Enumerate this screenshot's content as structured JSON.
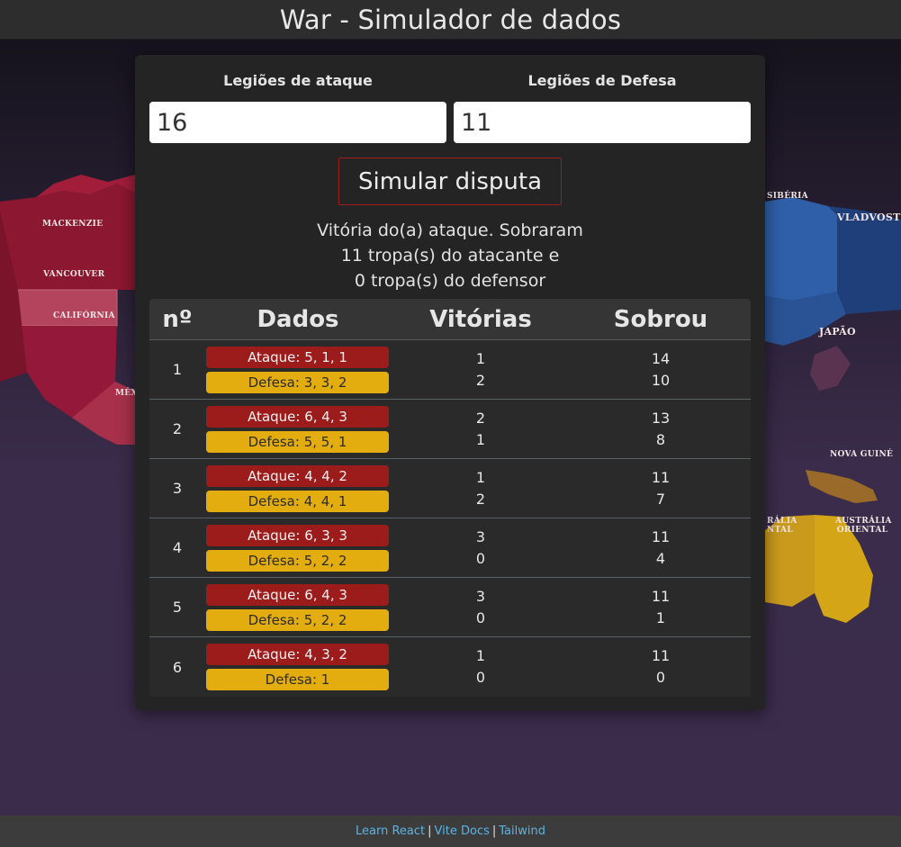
{
  "header": {
    "title": "War - Simulador de dados"
  },
  "map": {
    "labels": [
      "MACKENZIE",
      "VANCOUVER",
      "CALIFÓRNIA",
      "MÉX",
      "SIBÉRIA",
      "VLADVOSTOK",
      "JAPÃO",
      "NOVA GUINÉ",
      "AUSTRÁLIA ORIENTAL",
      "RÁLIA NTAL"
    ]
  },
  "form": {
    "attack_label": "Legiões de ataque",
    "defense_label": "Legiões de Defesa",
    "attack_value": "16",
    "defense_value": "11",
    "simulate_label": "Simular disputa"
  },
  "result": {
    "line1": "Vitória do(a) ataque. Sobraram",
    "line2": "11 tropa(s) do atacante e",
    "line3": "0 tropa(s) do defensor"
  },
  "table": {
    "headers": {
      "n": "nº",
      "dados": "Dados",
      "vitorias": "Vitórias",
      "sobrou": "Sobrou"
    },
    "rows": [
      {
        "n": "1",
        "ataque": "Ataque: 5, 1, 1",
        "defesa": "Defesa: 3, 3, 2",
        "vit_atk": "1",
        "vit_def": "2",
        "sob_atk": "14",
        "sob_def": "10"
      },
      {
        "n": "2",
        "ataque": "Ataque: 6, 4, 3",
        "defesa": "Defesa: 5, 5, 1",
        "vit_atk": "2",
        "vit_def": "1",
        "sob_atk": "13",
        "sob_def": "8"
      },
      {
        "n": "3",
        "ataque": "Ataque: 4, 4, 2",
        "defesa": "Defesa: 4, 4, 1",
        "vit_atk": "1",
        "vit_def": "2",
        "sob_atk": "11",
        "sob_def": "7"
      },
      {
        "n": "4",
        "ataque": "Ataque: 6, 3, 3",
        "defesa": "Defesa: 5, 2, 2",
        "vit_atk": "3",
        "vit_def": "0",
        "sob_atk": "11",
        "sob_def": "4"
      },
      {
        "n": "5",
        "ataque": "Ataque: 6, 4, 3",
        "defesa": "Defesa: 5, 2, 2",
        "vit_atk": "3",
        "vit_def": "0",
        "sob_atk": "11",
        "sob_def": "1"
      },
      {
        "n": "6",
        "ataque": "Ataque: 4, 3, 2",
        "defesa": "Defesa: 1",
        "vit_atk": "1",
        "vit_def": "0",
        "sob_atk": "11",
        "sob_def": "0"
      }
    ]
  },
  "footer": {
    "links": [
      "Learn React",
      "Vite Docs",
      "Tailwind"
    ],
    "separator": "|"
  },
  "colors": {
    "attack": "#9c1b1b",
    "defense": "#e3ad0f",
    "link": "#5ab4e6",
    "button_border": "#a11c1c"
  }
}
